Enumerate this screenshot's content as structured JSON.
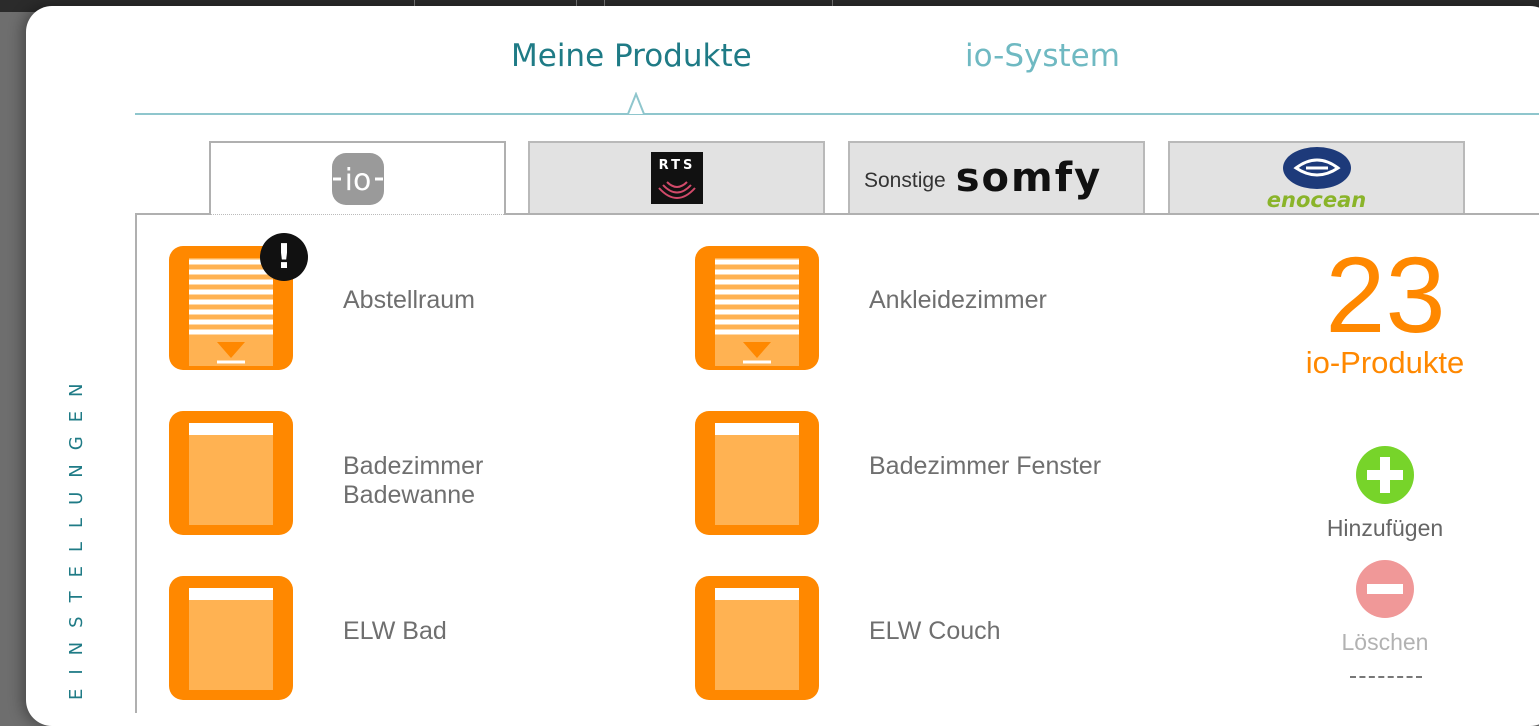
{
  "tabs": [
    {
      "label": "Meine Produkte",
      "active": true
    },
    {
      "label": "io-System",
      "active": false
    }
  ],
  "side_label": "EINSTELLUNGEN",
  "brand_tabs": [
    {
      "id": "io",
      "logo_text": "io",
      "active": true
    },
    {
      "id": "rts",
      "logo_text": "RTS",
      "active": false
    },
    {
      "id": "somfy",
      "prefix": "Sonstige",
      "logo_text": "somfy",
      "active": false
    },
    {
      "id": "enocean",
      "logo_text": "enocean",
      "active": false
    }
  ],
  "products": [
    {
      "name": "Abstellraum",
      "icon": "roller-shutter-down-icon",
      "warning": true
    },
    {
      "name": "Ankleidezimmer",
      "icon": "roller-shutter-down-icon",
      "warning": false
    },
    {
      "name": "Badezimmer Badewanne",
      "icon": "roller-shutter-open-icon",
      "warning": false
    },
    {
      "name": "Badezimmer Fenster",
      "icon": "roller-shutter-open-icon",
      "warning": false
    },
    {
      "name": "ELW Bad",
      "icon": "roller-shutter-open-icon",
      "warning": false
    },
    {
      "name": "ELW Couch",
      "icon": "roller-shutter-open-icon",
      "warning": false
    }
  ],
  "summary": {
    "count": "23",
    "label": "io-Produkte"
  },
  "actions": {
    "add_label": "Hinzufügen",
    "delete_label": "Löschen"
  },
  "warning_symbol": "!",
  "colors": {
    "accent": "#1f7b86",
    "accent_light": "#6fb9c2",
    "product_orange": "#ff8800",
    "add_green": "#77d42a",
    "delete_red": "#f09898"
  }
}
